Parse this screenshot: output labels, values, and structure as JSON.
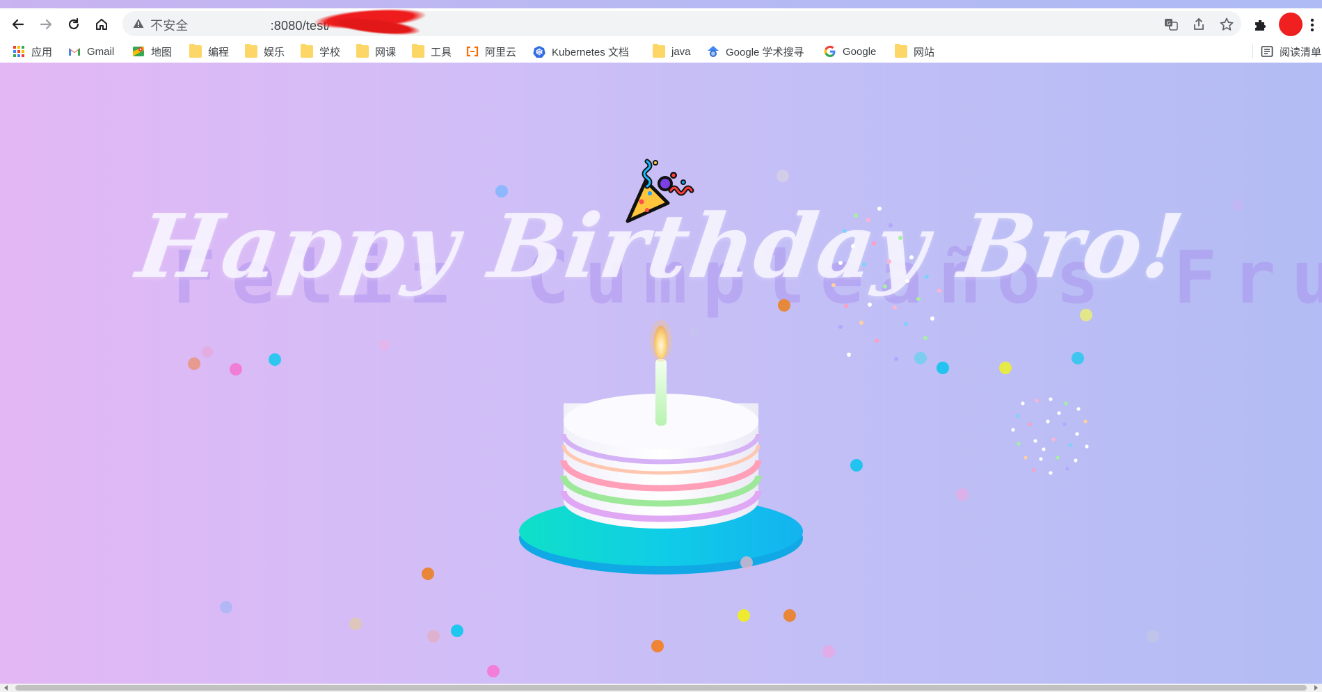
{
  "browser": {
    "url_warning": "不安全",
    "url_visible": ":8080/test/",
    "bookmarks": [
      {
        "label": "应用",
        "icon": "apps-grid-icon"
      },
      {
        "label": "Gmail",
        "icon": "gmail-icon"
      },
      {
        "label": "地图",
        "icon": "maps-icon"
      },
      {
        "label": "编程",
        "icon": "folder-icon"
      },
      {
        "label": "娱乐",
        "icon": "folder-icon"
      },
      {
        "label": "学校",
        "icon": "folder-icon"
      },
      {
        "label": "网课",
        "icon": "folder-icon"
      },
      {
        "label": "工具",
        "icon": "folder-icon"
      },
      {
        "label": "阿里云",
        "icon": "aliyun-icon"
      },
      {
        "label": "Kubernetes 文档",
        "icon": "kubernetes-icon"
      },
      {
        "label": "java",
        "icon": "folder-icon"
      },
      {
        "label": "Google 学术搜寻",
        "icon": "scholar-icon"
      },
      {
        "label": "Google",
        "icon": "google-icon"
      },
      {
        "label": "网站",
        "icon": "folder-icon"
      }
    ],
    "reading_list": "阅读清单"
  },
  "page": {
    "title": "Happy Birthday Bro!",
    "subtitle": "Feliz Cumpleaños Frutik!"
  },
  "colors": {
    "bg_left": "#e2b7f4",
    "bg_right": "#b3bcf4",
    "plate": "#11d9dd",
    "candle_flame": "#fcd27a"
  }
}
